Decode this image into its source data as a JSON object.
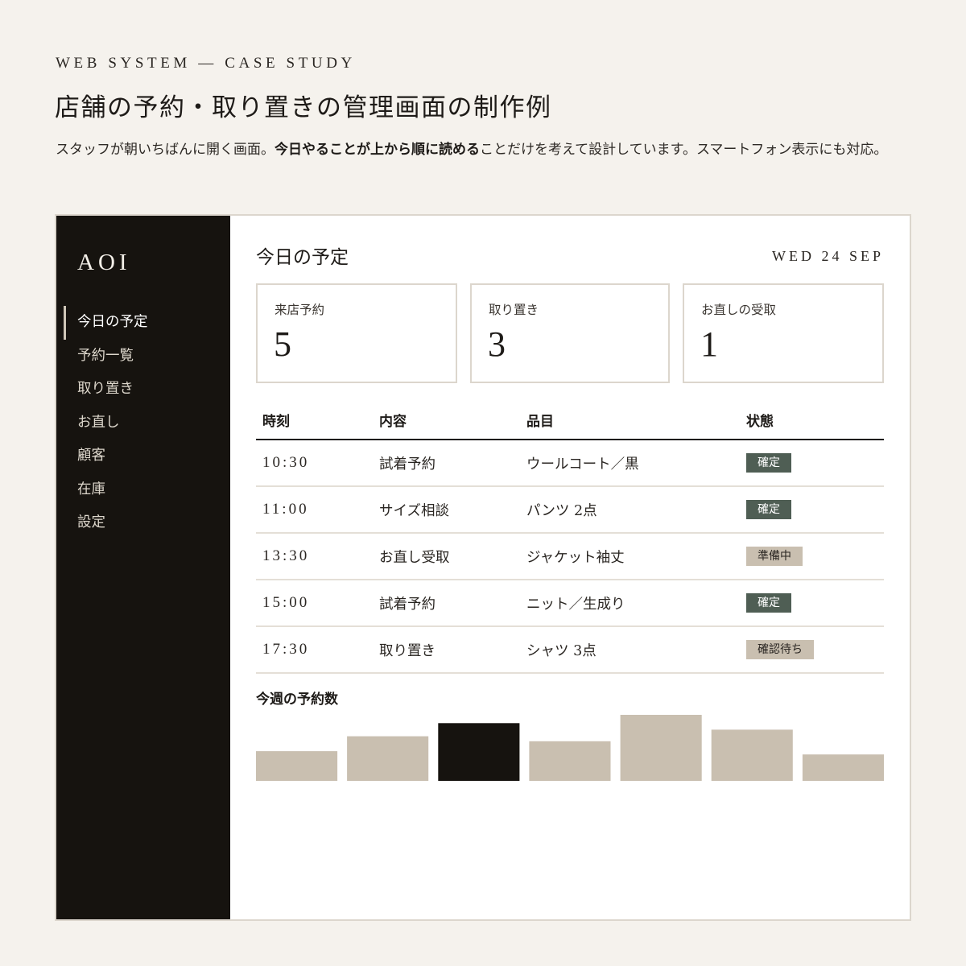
{
  "intro": {
    "eyebrow": "WEB SYSTEM — CASE STUDY",
    "title": "店舗の予約・取り置きの管理画面の制作例",
    "lead_before": "スタッフが朝いちばんに開く画面。",
    "lead_bold": "今日やることが上から順に読める",
    "lead_after": "ことだけを考えて設計しています。スマートフォン表示にも対応。"
  },
  "sidebar": {
    "logo": "AOI",
    "items": [
      {
        "label": "今日の予定",
        "active": true
      },
      {
        "label": "予約一覧"
      },
      {
        "label": "取り置き"
      },
      {
        "label": "お直し"
      },
      {
        "label": "顧客"
      },
      {
        "label": "在庫"
      },
      {
        "label": "設定"
      }
    ]
  },
  "header": {
    "title": "今日の予定",
    "date": "WED 24 SEP"
  },
  "stats": [
    {
      "label": "来店予約",
      "value": "5"
    },
    {
      "label": "取り置き",
      "value": "3"
    },
    {
      "label": "お直しの受取",
      "value": "1"
    }
  ],
  "schedule": {
    "columns": [
      "時刻",
      "内容",
      "品目",
      "状態"
    ],
    "rows": [
      {
        "time": "10:30",
        "content": "試着予約",
        "item": "ウールコート／黒",
        "status": "確定",
        "status_type": "confirmed"
      },
      {
        "time": "11:00",
        "content": "サイズ相談",
        "item": "パンツ 2点",
        "status": "確定",
        "status_type": "confirmed"
      },
      {
        "time": "13:30",
        "content": "お直し受取",
        "item": "ジャケット袖丈",
        "status": "準備中",
        "status_type": "pending"
      },
      {
        "time": "15:00",
        "content": "試着予約",
        "item": "ニット／生成り",
        "status": "確定",
        "status_type": "confirmed"
      },
      {
        "time": "17:30",
        "content": "取り置き",
        "item": "シャツ 3点",
        "status": "確認待ち",
        "status_type": "pending"
      }
    ]
  },
  "colors": {
    "confirmed": "#4f5e54",
    "pending": "#c9bfb0",
    "bar": "#c9bfb0",
    "bar_highlight": "#16130f"
  },
  "weekly": {
    "title": "今週の予約数",
    "chart_data": {
      "type": "bar",
      "categories": [],
      "values": [
        4.5,
        6.75,
        8.75,
        6,
        10,
        7.75,
        4
      ],
      "highlight_index": 2,
      "title": "",
      "xlabel": "",
      "ylabel": "",
      "ylim": [
        0,
        10
      ],
      "grid": false
    }
  }
}
